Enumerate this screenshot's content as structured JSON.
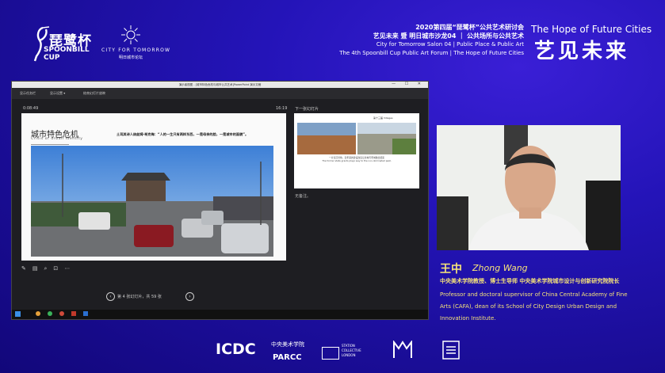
{
  "header": {
    "spoonbill_cn": "琵鹭杯",
    "spoonbill_en_1": "SPOONBILL",
    "spoonbill_en_2": "CUP",
    "ctt_en": "CITY FOR TOMORROW",
    "ctt_cn": "明日城市论坛",
    "forum_line1": "2020第四届“琵鹭杯”公共艺术研讨会",
    "forum_line2": "艺见未来 暨 明日城市沙龙04 ｜ 公共场所与公共艺术",
    "forum_line3": "City for Tomorrow Salon 04 | Public Place & Public Art",
    "forum_line4": "The 4th Spoonbill Cup Public Art Forum | The Hope of Future Cities",
    "hope_en": "The Hope of Future Cities",
    "hope_cn": "艺见未来"
  },
  "presenter_window": {
    "title": "演示者视图 - [城市特色危机与城市公共艺术]PowerPoint 演示文稿",
    "toolbar": [
      "显示任务栏",
      "显示设置 ▾",
      "结束幻灯片放映"
    ],
    "timer": "0:08:49",
    "clock": "16:19",
    "next_label": "下一张幻灯片",
    "notes": "无备注。",
    "pager": "第 4 张幻灯片，共 59 张",
    "slide": {
      "title": "城市特色危机",
      "subtitle": "Crisis of urban identity",
      "quote": "土耳其诗人纳兹姆·希克梅：“人的一生只有两样东西，一是母亲的脸，一是城市的面貌”。"
    },
    "next_slide": {
      "title": "第十三届 Villages",
      "caption_1": "一片荒凉景象。近年来的建设改造让新城与老城融合起来",
      "caption_2": "The former state grants plays way to the non-dominated past."
    }
  },
  "speaker": {
    "name_cn": "王中",
    "name_en": "Zhong Wang",
    "title_cn": "中央美术学院教授、博士生导师  中央美术学院城市设计与创新研究院院长",
    "title_en": "Professor and doctoral supervisor of China Central Academy of Fine Arts (CAFA), dean of its School of City Design Urban Design and Innovation Institute."
  },
  "footer": {
    "icdc": "ICDC",
    "cafa_cn": "中央美术学院",
    "parcc": "PARCC",
    "station": "STATION COLLECTIVE LONDON"
  },
  "colors": {
    "background": "#2414b8",
    "accent": "#f5e27a"
  }
}
